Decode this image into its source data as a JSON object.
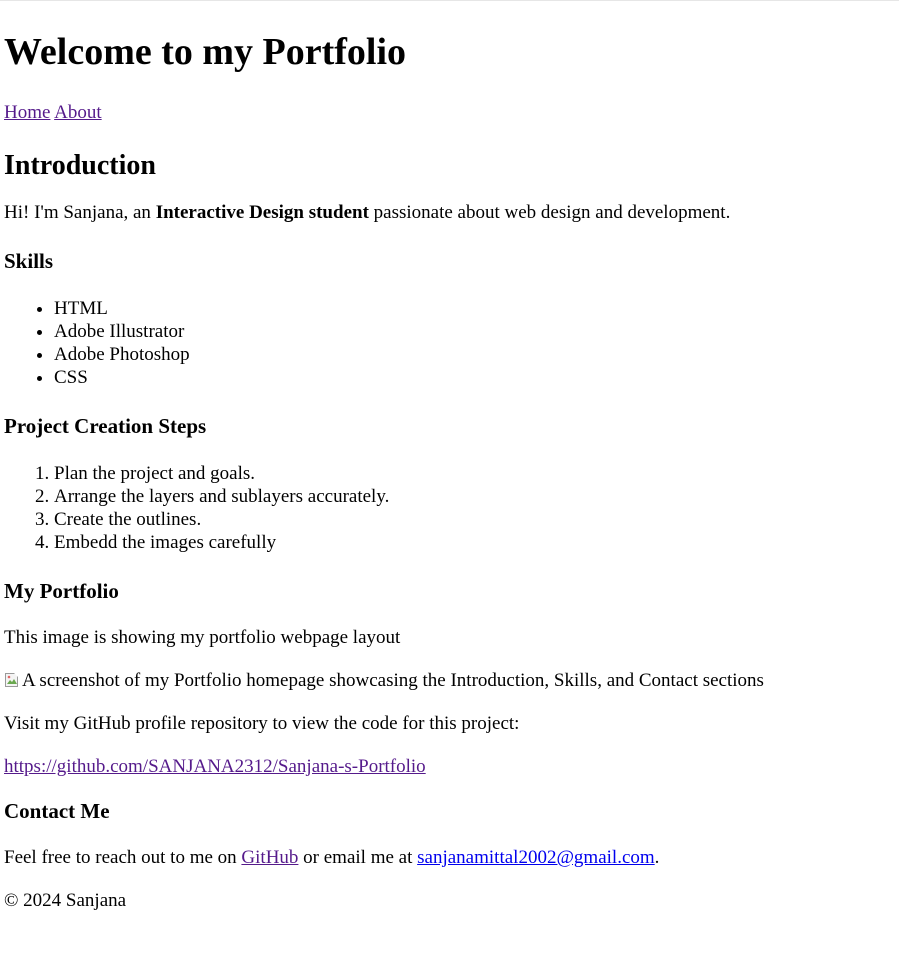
{
  "header": {
    "title": "Welcome to my Portfolio"
  },
  "nav": {
    "items": [
      {
        "label": "Home"
      },
      {
        "label": "About"
      }
    ]
  },
  "intro": {
    "heading": "Introduction",
    "text_before": "Hi! I'm Sanjana, an ",
    "bold": "Interactive Design student",
    "text_after": " passionate about web design and development."
  },
  "skills": {
    "heading": "Skills",
    "items": [
      "HTML",
      "Adobe Illustrator",
      "Adobe Photoshop",
      "CSS"
    ]
  },
  "steps": {
    "heading": "Project Creation Steps",
    "items": [
      "Plan the project and goals.",
      "Arrange the layers and sublayers accurately.",
      "Create the outlines.",
      "Embedd the images carefully"
    ]
  },
  "portfolio": {
    "heading": "My Portfolio",
    "description": "This image is showing my portfolio webpage layout",
    "image_alt": "A screenshot of my Portfolio homepage showcasing the Introduction, Skills, and Contact sections",
    "github_text": "Visit my GitHub profile repository to view the code for this project:",
    "github_link": "https://github.com/SANJANA2312/Sanjana-s-Portfolio"
  },
  "contact": {
    "heading": "Contact Me",
    "text_before": "Feel free to reach out to me on ",
    "github_label": "GitHub",
    "text_middle": " or email me at ",
    "email": "sanjanamittal2002@gmail.com",
    "text_end": "."
  },
  "footer": {
    "copyright": "© 2024 Sanjana"
  },
  "colors": {
    "visited_link": "#551a8b",
    "unvisited_link": "#0000ee"
  }
}
